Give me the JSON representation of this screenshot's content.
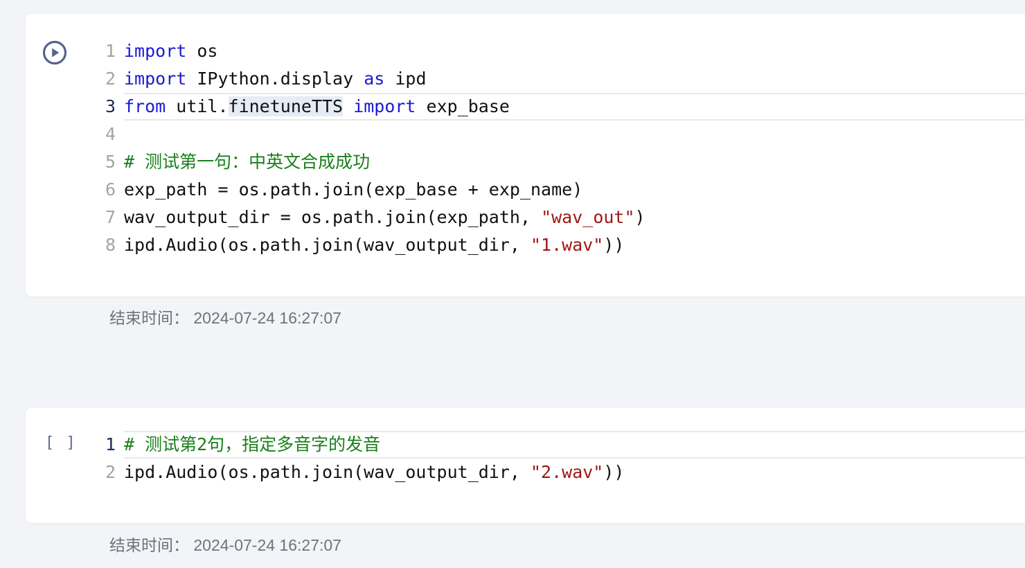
{
  "cells": [
    {
      "status": "run-icon",
      "lines": [
        {
          "num": "1",
          "tokens": [
            {
              "t": "import",
              "c": "kw"
            },
            {
              "t": " os",
              "c": ""
            }
          ]
        },
        {
          "num": "2",
          "tokens": [
            {
              "t": "import",
              "c": "kw"
            },
            {
              "t": " IPython.display ",
              "c": ""
            },
            {
              "t": "as",
              "c": "kw"
            },
            {
              "t": " ipd",
              "c": ""
            }
          ]
        },
        {
          "num": "3",
          "active": true,
          "tokens": [
            {
              "t": "from",
              "c": "kw"
            },
            {
              "t": " util.",
              "c": ""
            },
            {
              "t": "finetuneTTS",
              "c": "hl"
            },
            {
              "t": " ",
              "c": ""
            },
            {
              "t": "import",
              "c": "kw"
            },
            {
              "t": " exp_base",
              "c": ""
            }
          ]
        },
        {
          "num": "4",
          "tokens": []
        },
        {
          "num": "5",
          "tokens": [
            {
              "t": "# 测试第一句：中英文合成成功",
              "c": "com"
            }
          ]
        },
        {
          "num": "6",
          "tokens": [
            {
              "t": "exp_path = os.path.join(exp_base + exp_name)",
              "c": ""
            }
          ]
        },
        {
          "num": "7",
          "tokens": [
            {
              "t": "wav_output_dir = os.path.join(exp_path, ",
              "c": ""
            },
            {
              "t": "\"wav_out\"",
              "c": "str"
            },
            {
              "t": ")",
              "c": ""
            }
          ]
        },
        {
          "num": "8",
          "tokens": [
            {
              "t": "ipd.Audio(os.path.join(wav_output_dir, ",
              "c": ""
            },
            {
              "t": "\"1.wav\"",
              "c": "str"
            },
            {
              "t": "))",
              "c": ""
            }
          ]
        }
      ],
      "end_time": "结束时间：  2024-07-24 16:27:07"
    },
    {
      "status_text": "[ ]",
      "lines": [
        {
          "num": "1",
          "active": true,
          "tokens": [
            {
              "t": "# 测试第2句，指定多音字的发音",
              "c": "com"
            }
          ]
        },
        {
          "num": "2",
          "tokens": [
            {
              "t": "ipd.Audio(os.path.join(wav_output_dir, ",
              "c": ""
            },
            {
              "t": "\"2.wav\"",
              "c": "str"
            },
            {
              "t": "))",
              "c": ""
            }
          ]
        }
      ],
      "end_time": "结束时间：  2024-07-24 16:27:07"
    }
  ],
  "colors": {
    "keyword": "#1a1ad6",
    "string": "#a21515",
    "comment": "#1a7f1a",
    "run_icon": "#56628f"
  }
}
